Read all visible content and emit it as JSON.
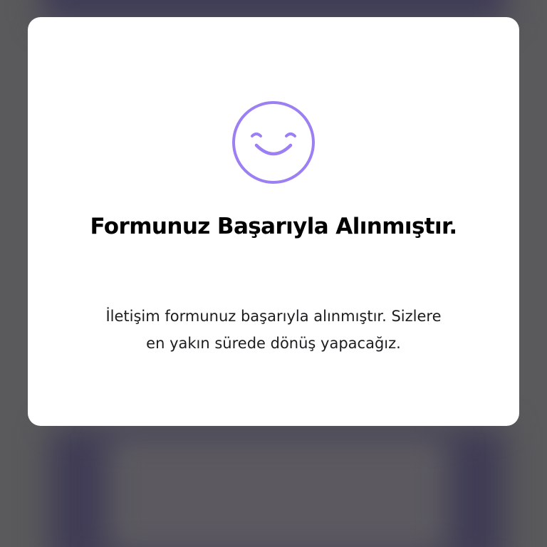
{
  "modal": {
    "icon": "smiley-face-icon",
    "title": "Formunuz Başarıyla Alınmıştır.",
    "message_line1": "İletişim formunuz başarıyla alınmıştır. Sizlere",
    "message_line2": "en yakın sürede dönüş yapacağız."
  },
  "colors": {
    "accent": "#9b7ff3",
    "overlay": "#5a5a5c",
    "card": "#ffffff"
  }
}
